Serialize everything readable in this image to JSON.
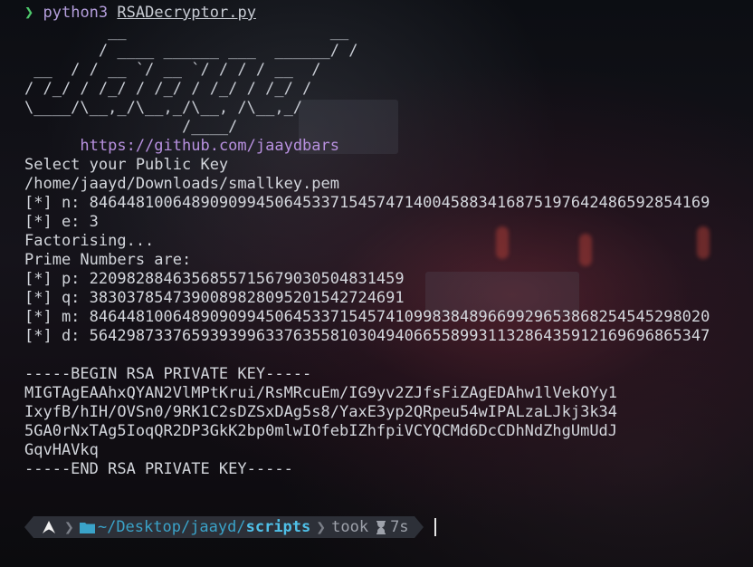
{
  "command": {
    "prompt_symbol": "❯",
    "program": "python3",
    "script": "RSADecryptor.py"
  },
  "banner_art": [
    "         __                      __",
    "        / ____ ______ ___  ______/ /",
    " __  / / __ `/ __ `/ / / / __  /",
    "/ /_/ / /_/ / /_/ / /_/ / /_/ /",
    "\\____/\\__,_/\\__,_/\\__, /\\__,_/",
    "                 /____/"
  ],
  "repo_link": "https://github.com/jaaydbars",
  "output": {
    "select_prompt": "Select your Public Key",
    "key_path": "/home/jaayd/Downloads/smallkey.pem",
    "n_line": "[*] n: 846448100648909099450645337154574714004588341687519764248659285416​9",
    "e_line": "[*] e: 3",
    "factorising": "Factorising...",
    "primes_header": "Prime Numbers are:",
    "p_line": "[*] p: 22098288463568557156790305048314​59",
    "q_line": "[*] q: 38303785473900898280952015427246​91",
    "m_line": "[*] m: 846448100648909099450645337154574109983848966992965386825454529802​0",
    "d_line": "[*] d: 564298733765939399633763558103049406655899311328643591216969686534​7"
  },
  "private_key": {
    "begin": "-----BEGIN RSA PRIVATE KEY-----",
    "lines": [
      "MIGTAgEAAhxQYAN2VlMPtKrui/RsMRcuEm/IG9yv2ZJfsFiZAgEDAhw1lVekOYy1",
      "IxyfB/hIH/OVSn0/9RK1C2sDZSxDAg5s8/YaxE3yp2QRpeu54wIPALzaLJkj3k34",
      "5GA0rNxTAg5IoqQR2DP3GkK2bp0mlwIOfebIZhfpiVCYQCMd6DcCDhNdZhgUmUdJ",
      "GqvHAVkq"
    ],
    "end": "-----END RSA PRIVATE KEY-----"
  },
  "status_bar": {
    "os_icon": "arch-linux-icon",
    "folder_icon": "folder-icon",
    "path_prefix": "~/Desktop/jaayd/",
    "path_current": "scripts",
    "took_label": "took",
    "timer_icon": "hourglass-icon",
    "duration": "7s"
  },
  "colors": {
    "prompt_green": "#4ec96c",
    "command_purple": "#b39ddb",
    "link_purple": "#b891e0",
    "path_blue": "#4fc0e8",
    "segment_bg": "#2d3038"
  }
}
